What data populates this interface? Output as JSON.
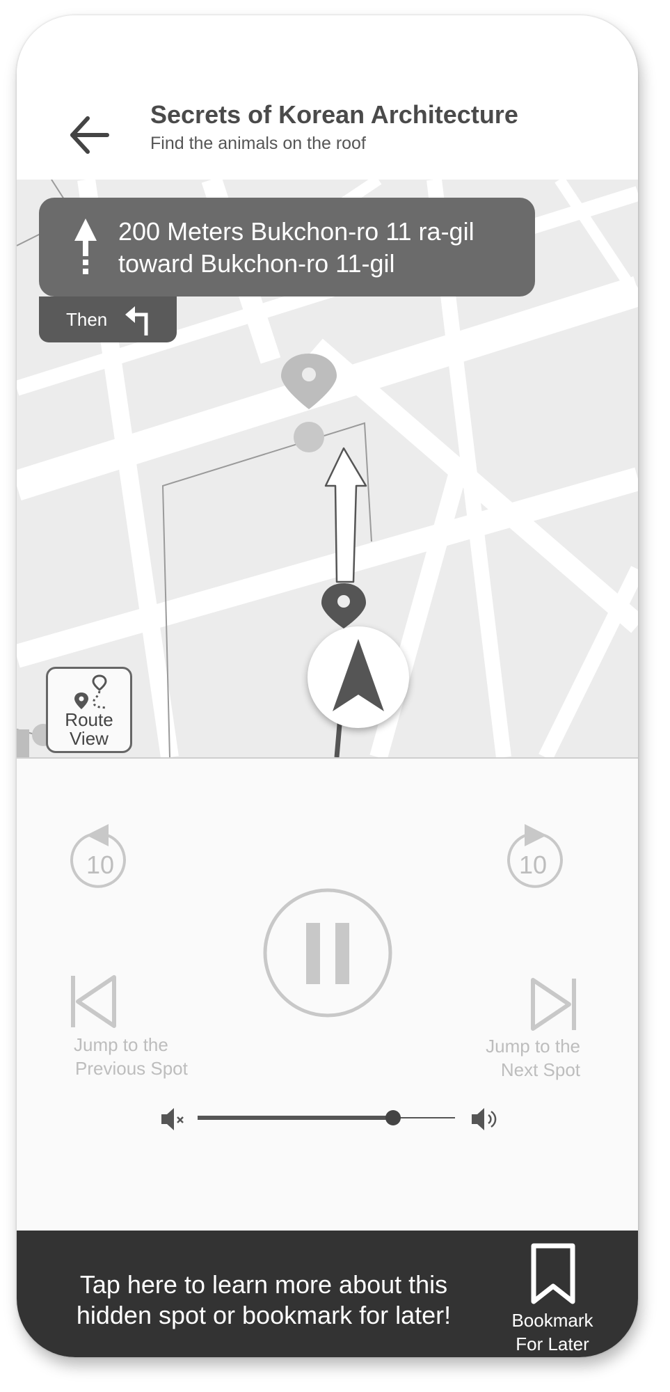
{
  "header": {
    "title": "Secrets of Korean Architecture",
    "subtitle": "Find the animals on the roof",
    "back_icon": "arrow-left-icon"
  },
  "navigation": {
    "direction_icon": "arrow-up-icon",
    "instruction_line1": "200 Meters Bukchon-ro 11 ra-gil",
    "instruction_line2": "toward Bukchon-ro 11-gil",
    "then_label": "Then",
    "then_icon": "turn-left-icon"
  },
  "map": {
    "route_view_label_line1": "Route",
    "route_view_label_line2": "View",
    "route_view_icon": "route-pins-icon",
    "compass_icon": "navigation-arrow-icon"
  },
  "player": {
    "rewind_seconds": "10",
    "forward_seconds": "10",
    "previous_label_line1": "Jump to the",
    "previous_label_line2": "Previous Spot",
    "next_label_line1": "Jump to the",
    "next_label_line2": "Next Spot",
    "play_state_icon": "pause-icon",
    "volume_level": 0.76,
    "mute_icon": "volume-mute-icon",
    "volume_icon": "volume-up-icon"
  },
  "banner": {
    "text": "Tap here to learn more about this hidden spot or bookmark for later!",
    "bookmark_label_line1": "Bookmark",
    "bookmark_label_line2": "For Later",
    "bookmark_icon": "bookmark-icon"
  },
  "colors": {
    "map_background": "#ececec",
    "road": "#ffffff",
    "nav_card": "#6b6b6b",
    "then_box": "#5a5a5a",
    "banner": "#333333",
    "controls_inactive": "#c8c8c8"
  }
}
